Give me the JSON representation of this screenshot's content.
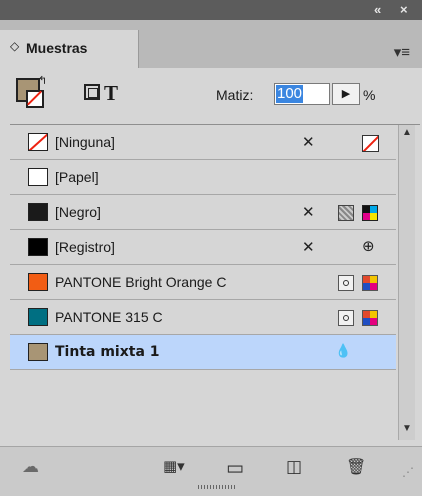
{
  "panel": {
    "title_buttons": {
      "collapse": "«",
      "close": "×"
    },
    "tab_label": "Muestras",
    "tab_chevron": "◇",
    "menu_icon": "▾≡"
  },
  "toolbar": {
    "tint_label": "Matiz:",
    "tint_value": "100",
    "tint_unit": "%",
    "tint_step_icon": "▶",
    "text_mode_icon": "T",
    "fill_color": "#a89575"
  },
  "swatches": [
    {
      "name": "[Ninguna]",
      "color": "none",
      "icons": [
        "no-edit-icon",
        "none-swatch-icon"
      ],
      "selected": false
    },
    {
      "name": "[Papel]",
      "color": "#ffffff",
      "icons": [],
      "selected": false
    },
    {
      "name": "[Negro]",
      "color": "#1a1a1a",
      "icons": [
        "no-edit-icon",
        "gray-swatch-icon",
        "cmyk-swatch-icon"
      ],
      "selected": false
    },
    {
      "name": "[Registro]",
      "color": "#000000",
      "icons": [
        "no-edit-icon",
        "registration-icon"
      ],
      "selected": false
    },
    {
      "name": "PANTONE Bright Orange C",
      "color": "#f25d14",
      "icons": [
        "spot-color-icon",
        "process-color-icon"
      ],
      "selected": false
    },
    {
      "name": "PANTONE 315 C",
      "color": "#006f82",
      "icons": [
        "spot-color-icon",
        "process-color-icon"
      ],
      "selected": false
    },
    {
      "name": "Tinta mixta 1",
      "color": "#a89575",
      "icons": [
        "mixed-ink-icon"
      ],
      "selected": true
    }
  ],
  "glyphs": {
    "no_edit": "✕",
    "registration": "⊕",
    "mixed_ink": "💧",
    "scroll_up": "▲",
    "scroll_down": "▼",
    "cloud": "☁",
    "grid": "▦▾",
    "folder": "▭",
    "new_swatch": "◫",
    "trash": "🗑",
    "resize": "⋰"
  }
}
